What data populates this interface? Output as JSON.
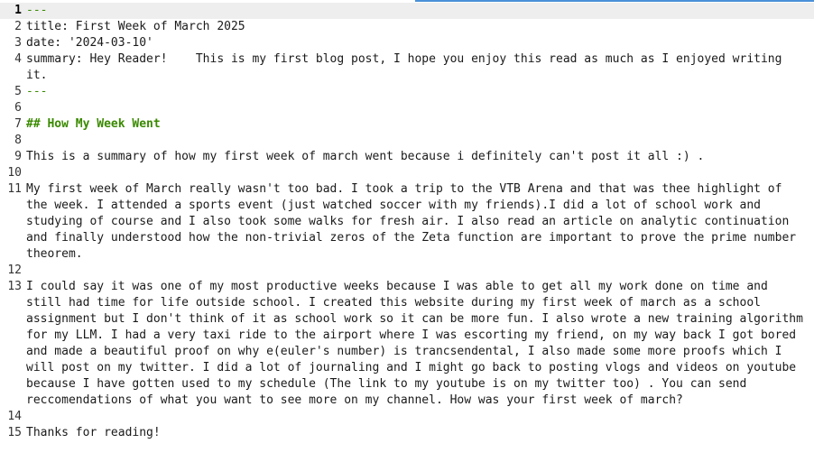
{
  "editor": {
    "lines": [
      {
        "num": "1",
        "text": "---"
      },
      {
        "num": "2",
        "text": "title: First Week of March 2025"
      },
      {
        "num": "3",
        "text": "date: '2024-03-10'"
      },
      {
        "num": "4",
        "text": "summary: Hey Reader!    This is my first blog post, I hope you enjoy this read as much as I enjoyed writing it."
      },
      {
        "num": "5",
        "text": "---"
      },
      {
        "num": "6",
        "text": ""
      },
      {
        "num": "7",
        "text": "## How My Week Went"
      },
      {
        "num": "8",
        "text": ""
      },
      {
        "num": "9",
        "text": "This is a summary of how my first week of march went because i definitely can't post it all :) ."
      },
      {
        "num": "10",
        "text": ""
      },
      {
        "num": "11",
        "text": "My first week of March really wasn't too bad. I took a trip to the VTB Arena and that was thee highlight of the week. I attended a sports event (just watched soccer with my friends).I did a lot of school work and studying of course and I also took some walks for fresh air. I also read an article on analytic continuation and finally understood how the non-trivial zeros of the Zeta function are important to prove the prime number theorem."
      },
      {
        "num": "12",
        "text": ""
      },
      {
        "num": "13",
        "text": "I could say it was one of my most productive weeks because I was able to get all my work done on time and still had time for life outside school. I created this website during my first week of march as a school assignment but I don't think of it as school work so it can be more fun. I also wrote a new training algorithm for my LLM. I had a very taxi ride to the airport where I was escorting my friend, on my way back I got bored and made a beautiful proof on why e(euler's number) is trancsendental, I also made some more proofs which I will post on my twitter. I did a lot of journaling and I might go back to posting vlogs and videos on youtube because I have gotten used to my schedule (The link to my youtube is on my twitter too) . You can send reccomendations of what you want to see more on my channel. How was your first week of march?"
      },
      {
        "num": "14",
        "text": ""
      },
      {
        "num": "15",
        "text": "Thanks for reading!"
      }
    ]
  },
  "colors": {
    "delimiter": "#3a8a00",
    "heading": "#3a8a00",
    "active_line": "#eeeeee",
    "accent": "#4a90d9"
  }
}
